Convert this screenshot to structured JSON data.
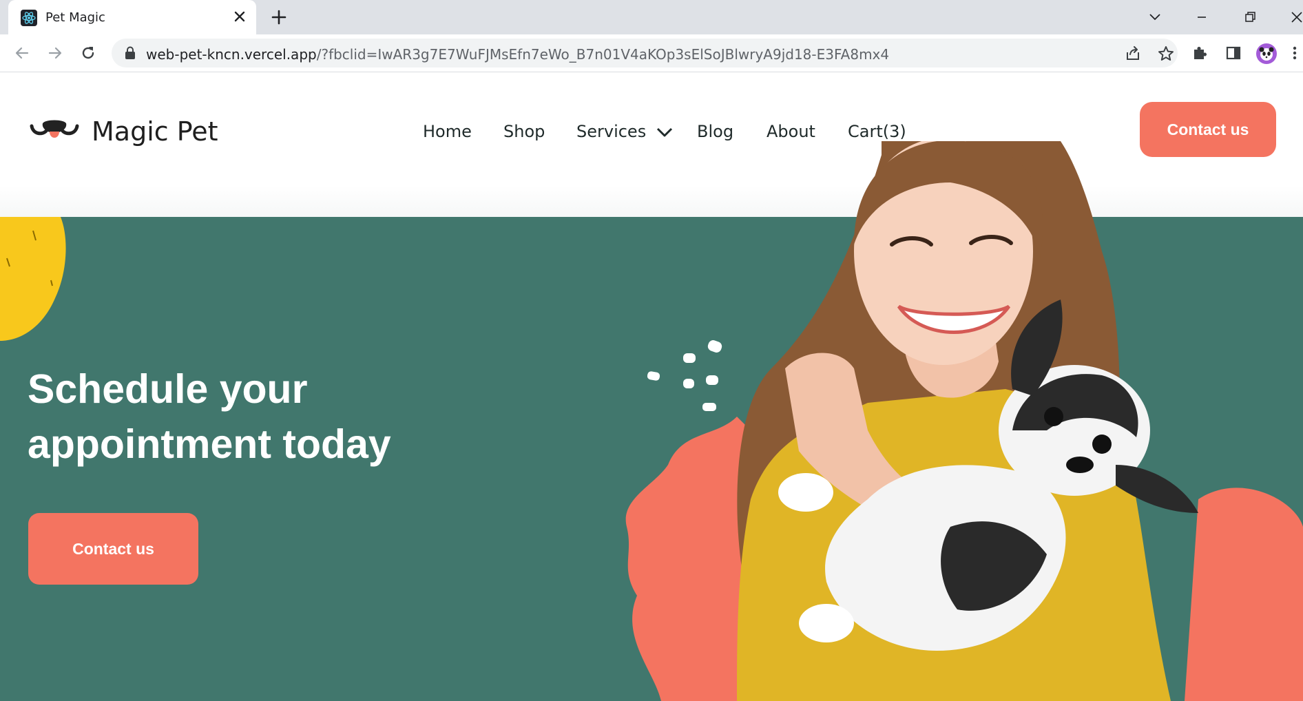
{
  "browser": {
    "tab_title": "Pet Magic",
    "url_host": "web-pet-kncn.vercel.app",
    "url_rest": "/?fbclid=IwAR3g7E7WuFJMsEfn7eWo_B7n01V4aKOp3sElSoJBlwryA9jd18-E3FA8mx4"
  },
  "site": {
    "brand": "Magic Pet",
    "nav": {
      "home": "Home",
      "shop": "Shop",
      "services": "Services",
      "blog": "Blog",
      "about": "About",
      "cart": "Cart(3)"
    },
    "contact_nav_label": "Contact us"
  },
  "hero": {
    "headline_line1": "Schedule your",
    "headline_line2": "appointment today",
    "cta_label": "Contact us"
  },
  "colors": {
    "hero_bg": "#41776d",
    "accent": "#f47460",
    "yellow": "#f8c81c",
    "shirt": "#e0b526"
  },
  "icons": [
    "react-icon",
    "close-icon",
    "plus-icon",
    "chevron-down-icon",
    "minimize-icon",
    "restore-icon",
    "back-icon",
    "forward-icon",
    "reload-icon",
    "lock-icon",
    "share-icon",
    "star-icon",
    "puzzle-icon",
    "sidepanel-icon",
    "kebab-icon",
    "paw-logo-icon"
  ]
}
